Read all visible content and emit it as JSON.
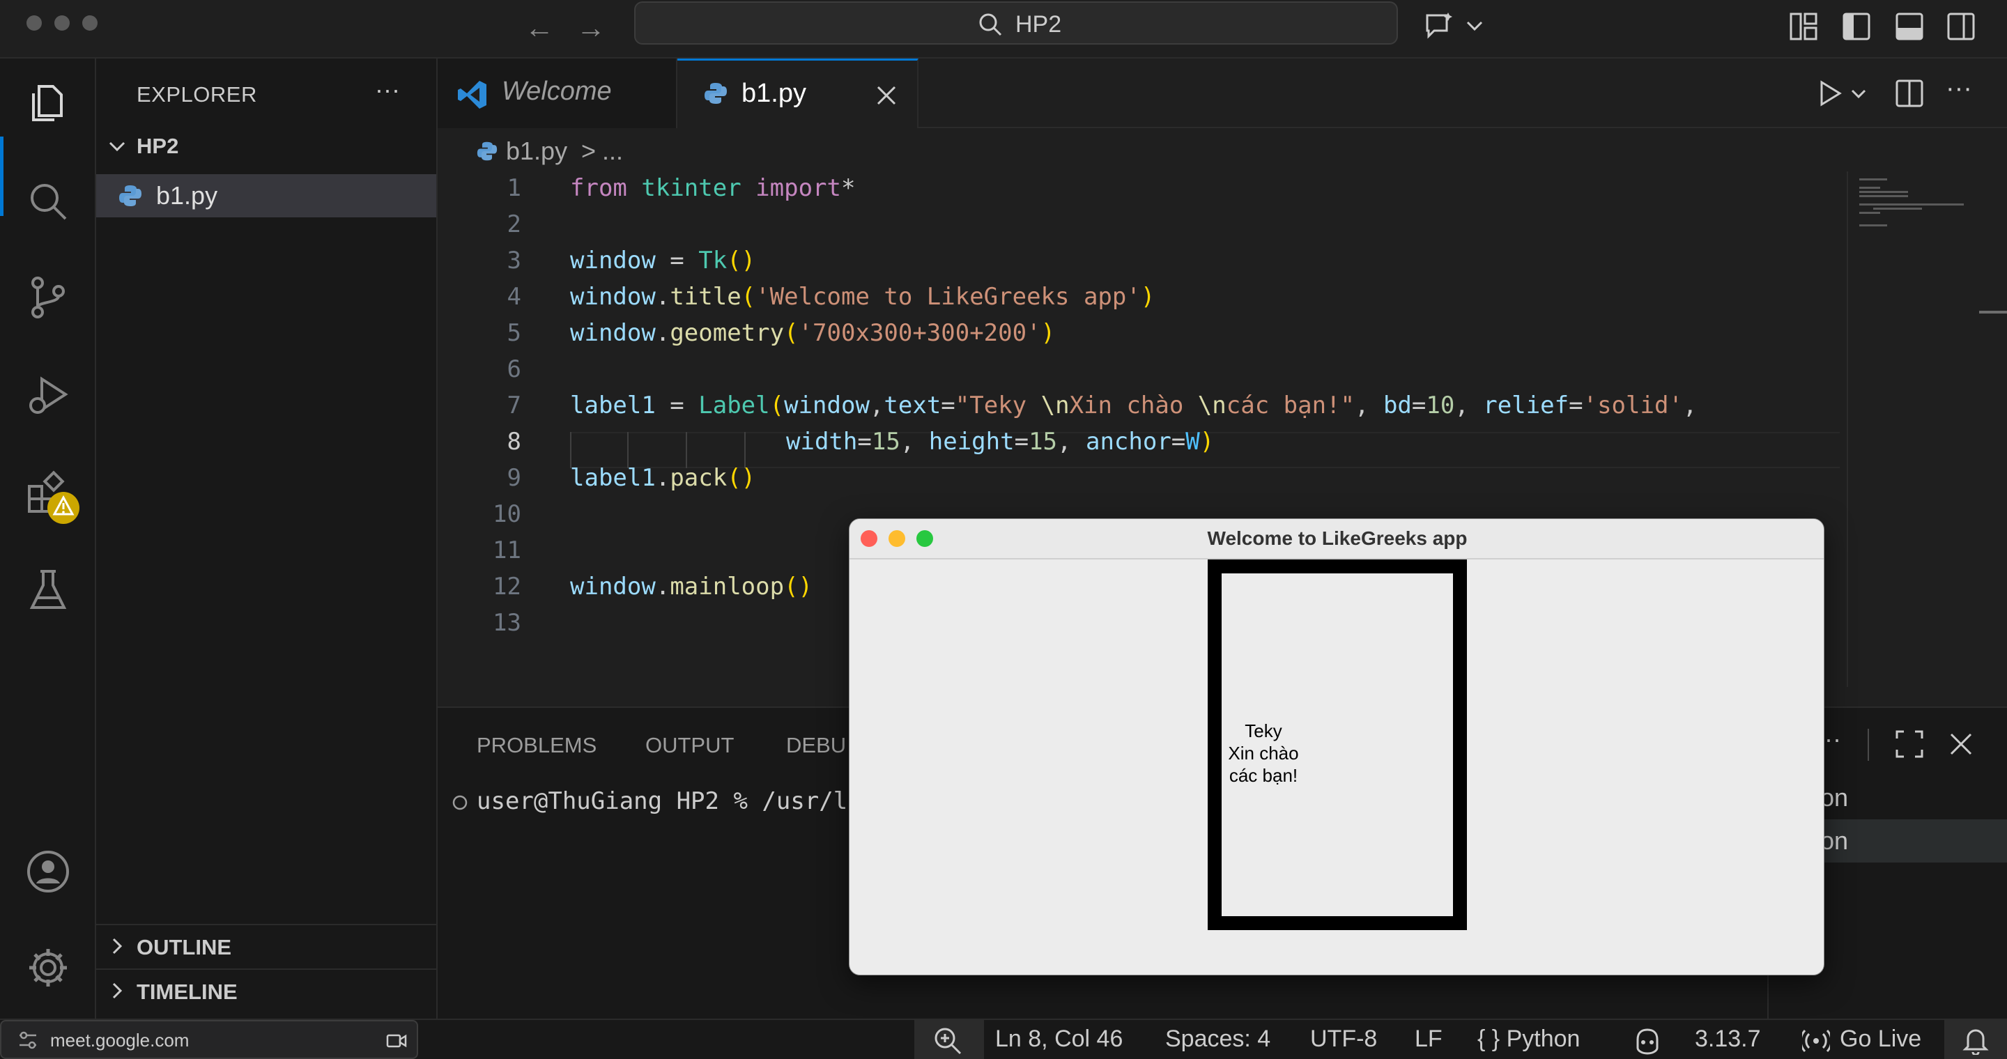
{
  "titlebar": {
    "search_text": "HP2",
    "icons": [
      "arrow-left-icon",
      "arrow-right-icon",
      "search-icon",
      "copilot-chat-icon",
      "chevron-down-icon",
      "customize-layout-icon",
      "toggle-primary-sidebar-icon",
      "toggle-panel-icon",
      "toggle-secondary-sidebar-icon"
    ]
  },
  "activitybar": {
    "items": [
      "explorer-icon",
      "search-icon",
      "source-control-icon",
      "run-debug-icon",
      "extensions-icon",
      "testing-icon",
      "accounts-icon",
      "settings-gear-icon"
    ],
    "badge": "warning-badge-icon"
  },
  "sidebar": {
    "title": "EXPLORER",
    "more": "···",
    "folder": "HP2",
    "files": [
      "b1.py"
    ],
    "outline": "OUTLINE",
    "timeline": "TIMELINE"
  },
  "editor": {
    "tabs": [
      {
        "label": "Welcome",
        "active": false
      },
      {
        "label": "b1.py",
        "active": true
      }
    ],
    "breadcrumb": {
      "file": "b1.py",
      "sep": ">",
      "more": "..."
    },
    "line_numbers": [
      "1",
      "2",
      "3",
      "4",
      "5",
      "6",
      "7",
      "8",
      "9",
      "10",
      "11",
      "12",
      "13"
    ],
    "current_line": 8
  },
  "panel": {
    "tabs": [
      "PROBLEMS",
      "OUTPUT",
      "DEBU"
    ],
    "terminal_line": "user@ThuGiang HP2 % /usr/lo",
    "terminals": [
      "Python",
      "Python"
    ],
    "more": "···"
  },
  "statusbar": {
    "tooltip": "meet.google.com",
    "position": "Ln 8, Col 46",
    "spaces": "Spaces: 4",
    "encoding": "UTF-8",
    "eol": "LF",
    "language": "{ } Python",
    "python_version": "3.13.7",
    "golive": "Go Live"
  },
  "tkapp": {
    "title": "Welcome to LikeGreeks app",
    "label_text": "Teky\nXin chào\ncác bạn!"
  },
  "colors": {
    "accent": "#0078d4",
    "warning": "#cca700",
    "tk_close": "#ff5f57",
    "tk_min": "#febc2e",
    "tk_max": "#28c840"
  }
}
